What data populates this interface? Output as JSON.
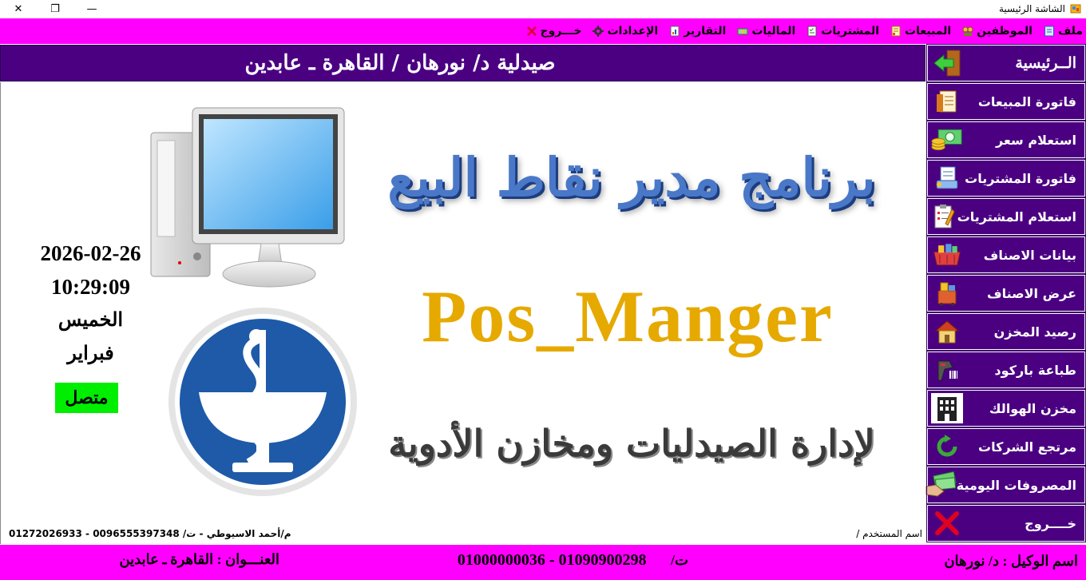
{
  "window": {
    "title": "الشاشة الرئيسية",
    "close": "✕",
    "maximize": "❐",
    "minimize": "—"
  },
  "menu": {
    "items": [
      {
        "label": "ملف",
        "icon": "file-icon"
      },
      {
        "label": "الموظفين",
        "icon": "employees-icon"
      },
      {
        "label": "المبيعات",
        "icon": "sales-icon"
      },
      {
        "label": "المشتريات",
        "icon": "purchases-icon"
      },
      {
        "label": "الماليات",
        "icon": "finance-icon"
      },
      {
        "label": "التقارير",
        "icon": "reports-icon"
      },
      {
        "label": "الإعدادات",
        "icon": "settings-icon"
      },
      {
        "label": "خـــروج",
        "icon": "exit-icon"
      }
    ]
  },
  "header": {
    "title": "صيدلية د/ نورهان / القاهرة ـ عابدين"
  },
  "main": {
    "title_ar": "برنامج مدير نقاط البيع",
    "title_en": "Pos_Manger",
    "subtitle": "لإدارة الصيدليات ومخازن الأدوية",
    "date": "2026-02-26",
    "time": "10:29:09",
    "day": "الخميس",
    "month": "فبراير",
    "status": "متصل",
    "credit": "م/أحمد الاسيوطي  - ت/ 0096555397348 - 01272026933",
    "user_label": "اسم المستخدم /"
  },
  "sidebar": {
    "items": [
      {
        "label": "الــرئيسية",
        "icon": "home-arrow-icon"
      },
      {
        "label": "فاتورة المبيعات",
        "icon": "sales-invoice-icon"
      },
      {
        "label": "استعلام سعر",
        "icon": "price-query-icon"
      },
      {
        "label": "فاتورة المشتريات",
        "icon": "purchase-invoice-icon"
      },
      {
        "label": "استعلام المشتريات",
        "icon": "purchase-query-icon"
      },
      {
        "label": "بيانات الاصناف",
        "icon": "items-data-icon"
      },
      {
        "label": "عرض الاصناف",
        "icon": "items-view-icon"
      },
      {
        "label": "رصيد المخزن",
        "icon": "store-balance-icon"
      },
      {
        "label": "طباعة باركود",
        "icon": "barcode-print-icon"
      },
      {
        "label": "مخزن الهوالك",
        "icon": "damaged-store-icon"
      },
      {
        "label": "مرتجع الشركات",
        "icon": "company-returns-icon"
      },
      {
        "label": "المصروفات اليومية",
        "icon": "daily-expenses-icon"
      },
      {
        "label": "خــــروج",
        "icon": "exit-x-icon"
      }
    ]
  },
  "footer": {
    "agent_label": "اسم الوكيل  :  د/ نورهان",
    "phone_label": "ت/",
    "phone_numbers": "01000000036 - 01090900298",
    "address_label": "العنـــوان  :  القاهرة ـ عابدين"
  },
  "colors": {
    "magenta": "#ff00ff",
    "purple": "#4b0082",
    "status_green": "#00ee00",
    "title_blue": "#4a78c8",
    "title_gold": "#e6a900"
  }
}
